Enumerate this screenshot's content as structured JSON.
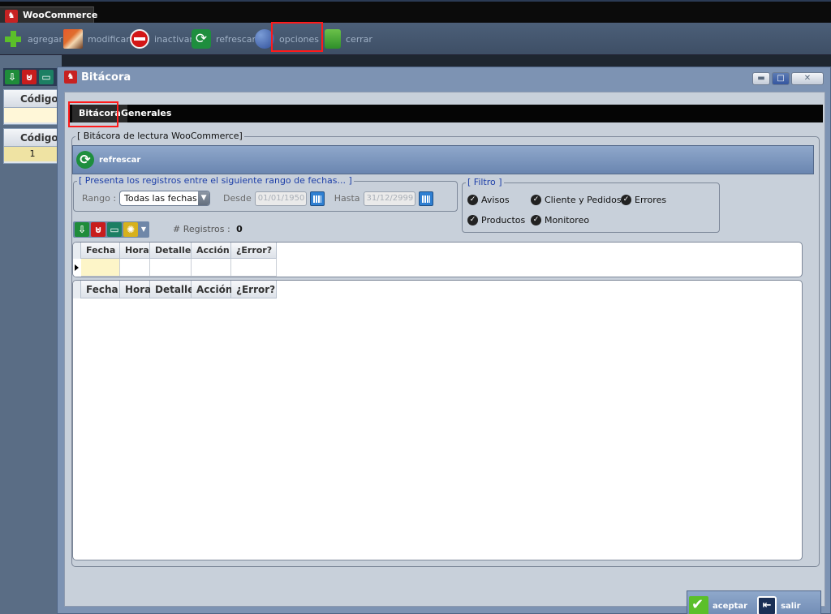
{
  "app": {
    "title": "WooCommerce"
  },
  "toolbar": {
    "agregar": "agregar",
    "modificar": "modificar",
    "inactivar": "inactivar",
    "refrescar": "refrescar",
    "opciones": "opciones",
    "cerrar": "cerrar"
  },
  "background": {
    "grid1_header": "Código",
    "grid2_header": "Código",
    "grid2_row1": "1"
  },
  "dialog": {
    "title": "Bitácora",
    "tabs": [
      "Bitácora",
      "Generales"
    ],
    "group_title": "[ Bitácora de lectura WooCommerce]",
    "refresh_label": "refrescar",
    "range_title": "[ Presenta los registros entre el siguiente rango de fechas... ]",
    "rango_label": "Rango :",
    "rango_value": "Todas las fechas",
    "desde_label": "Desde",
    "desde_value": "01/01/1950",
    "hasta_label": "Hasta",
    "hasta_value": "31/12/2999",
    "filter_title": "[ Filtro ]",
    "filters": [
      "Avisos",
      "Cliente y Pedidos",
      "Errores",
      "Productos",
      "Monitoreo"
    ],
    "registros_label": "# Registros :",
    "registros_value": "0",
    "columns": [
      "Fecha",
      "Hora",
      "Detalle",
      "Acción",
      "¿Error?"
    ],
    "aceptar": "aceptar",
    "salir": "salir"
  }
}
